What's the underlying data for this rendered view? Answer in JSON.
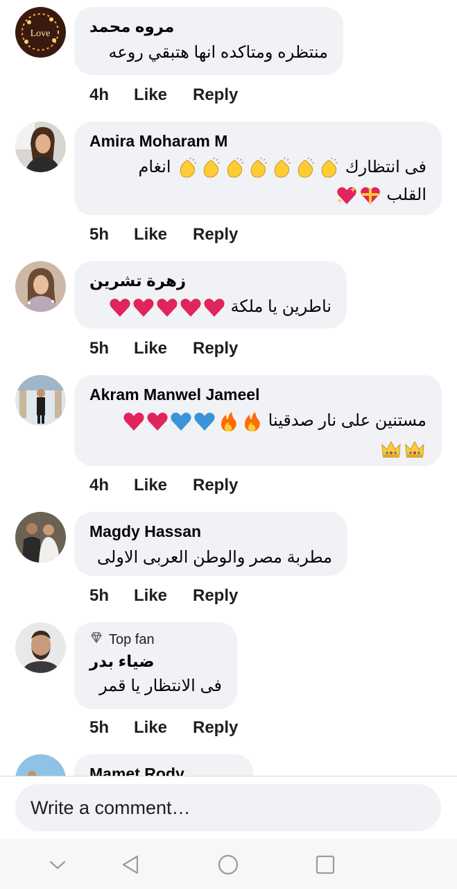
{
  "actions": {
    "like": "Like",
    "reply": "Reply"
  },
  "comments": [
    {
      "name": "مروه محمد",
      "lines": [
        "منتظره ومتاكده انها هتبقي روعه"
      ],
      "time": "4h"
    },
    {
      "name": "Amira Moharam M",
      "lines": [
        "فى انتظارك 👏👏👏👏👏👏👏 انغام",
        "القلب 💝💖"
      ],
      "time": "5h"
    },
    {
      "name": "زهرة تشرين",
      "lines": [
        "ناطرين يا ملكة ❤❤❤❤❤"
      ],
      "time": "5h"
    },
    {
      "name": "Akram Manwel Jameel",
      "lines": [
        "مستنين على نار صدقينا 🔥🔥💙💙❤❤",
        "👑👑"
      ],
      "time": "4h"
    },
    {
      "name": "Magdy Hassan",
      "lines": [
        "مطربة مصر والوطن العربى الاولى"
      ],
      "time": "5h"
    },
    {
      "badge": "Top fan",
      "name": "ضياء بدر",
      "lines": [
        "فى الانتظار يا قمر"
      ],
      "time": "5h"
    },
    {
      "name": "Mamet Rody"
    }
  ],
  "composer": {
    "placeholder": "Write a comment…"
  },
  "colors": {
    "bubble": "#f0f2f5",
    "heart": "#e0245e",
    "blue_heart": "#3b94d9",
    "clap": "#ffcc33"
  }
}
